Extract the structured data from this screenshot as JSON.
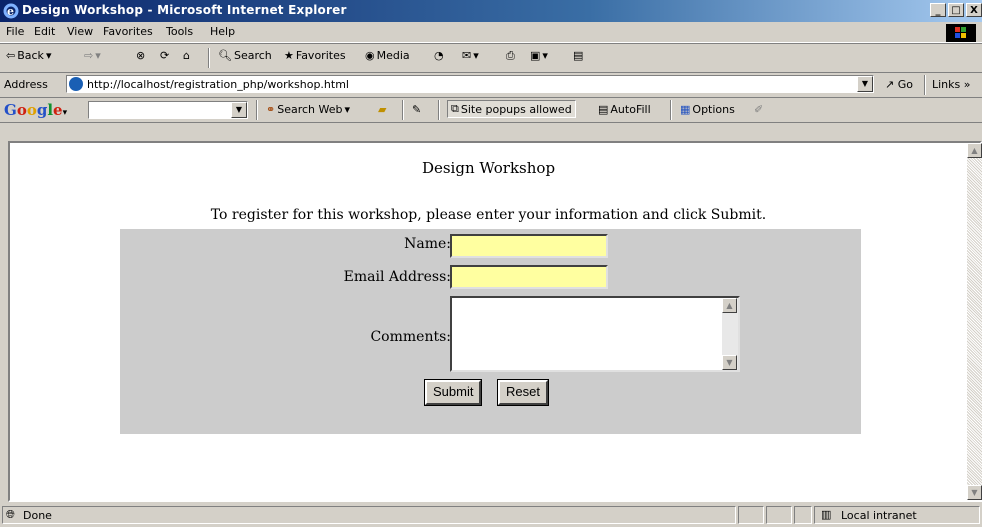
{
  "window": {
    "title": "Design Workshop - Microsoft Internet Explorer",
    "controls": [
      "_",
      "□",
      "X"
    ]
  },
  "menubar": [
    "File",
    "Edit",
    "View",
    "Favorites",
    "Tools",
    "Help"
  ],
  "toolbar": {
    "back": "Back",
    "search": "Search",
    "favorites": "Favorites",
    "media": "Media"
  },
  "addressbar": {
    "label": "Address",
    "url": "http://localhost/registration_php/workshop.html",
    "go": "Go",
    "links": "Links »"
  },
  "googlebar": {
    "logo": [
      "G",
      "o",
      "o",
      "g",
      "l",
      "e"
    ],
    "search_value": "",
    "search_web": "Search Web",
    "popups": "Site popups allowed",
    "autofill": "AutoFill",
    "options": "Options"
  },
  "page": {
    "title": "Design Workshop",
    "intro": "To register for this workshop, please enter your information and click Submit.",
    "form": {
      "name_label": "Name:",
      "name_value": "",
      "email_label": "Email Address:",
      "email_value": "",
      "comments_label": "Comments:",
      "comments_value": "",
      "submit": "Submit",
      "reset": "Reset"
    }
  },
  "statusbar": {
    "status": "Done",
    "zone": "Local intranet"
  },
  "colors": {
    "titlebar": "#0a246a",
    "chrome": "#d4d0c8",
    "field_highlight": "#ffffa0",
    "form_bg": "#cccccc"
  }
}
